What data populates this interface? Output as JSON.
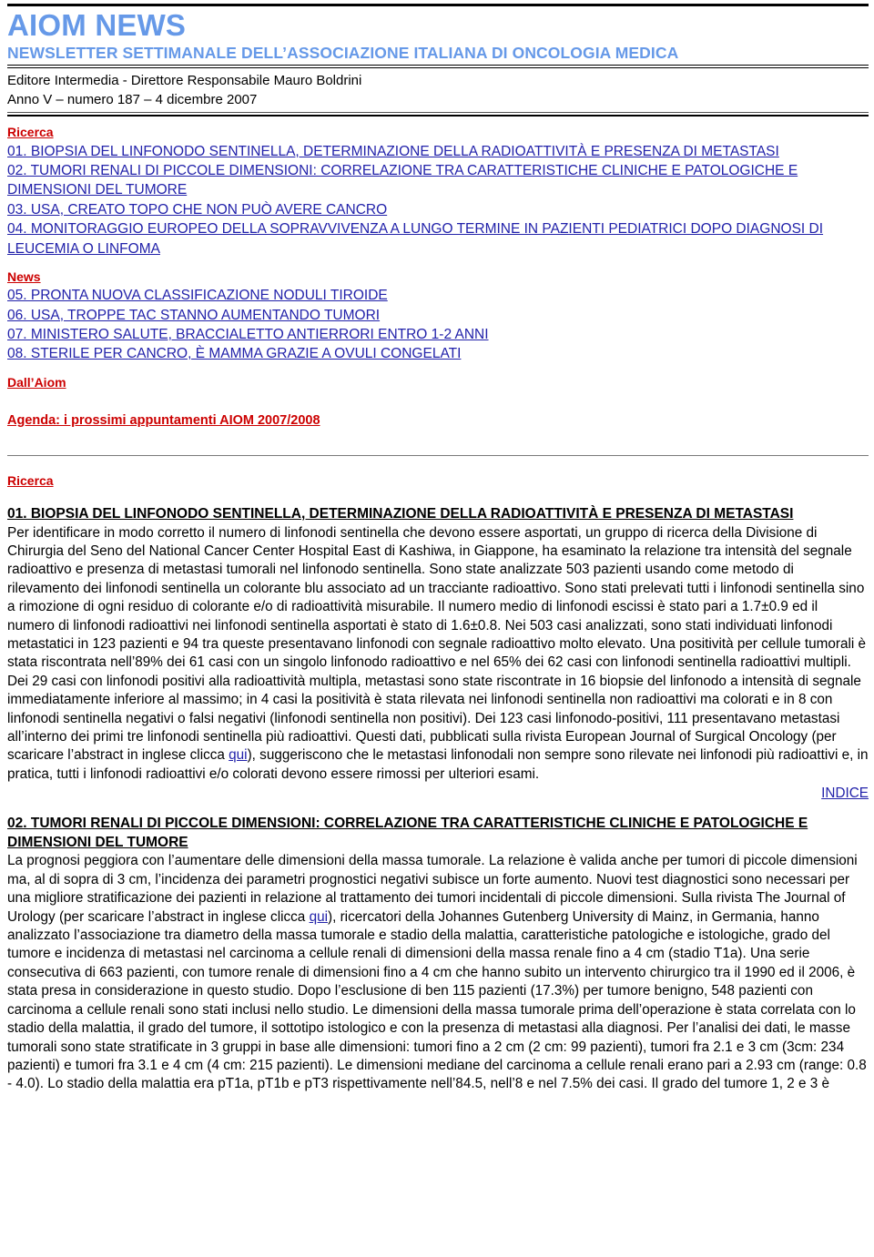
{
  "masthead": {
    "title": "AIOM NEWS",
    "subtitle": "NEWSLETTER SETTIMANALE DELL’ASSOCIAZIONE ITALIANA DI ONCOLOGIA MEDICA",
    "publisher": "Editore Intermedia - Direttore Responsabile Mauro Boldrini",
    "issue": "Anno V – numero 187 – 4 dicembre 2007",
    "title_color": "#6699e8",
    "rule_color": "#000000"
  },
  "toc": {
    "category_ricerca": "Ricerca",
    "items_ricerca": [
      "01. BIOPSIA DEL LINFONODO SENTINELLA, DETERMINAZIONE DELLA RADIOATTIVITÀ E PRESENZA DI METASTASI",
      "02. TUMORI RENALI DI PICCOLE DIMENSIONI: CORRELAZIONE TRA CARATTERISTICHE CLINICHE E PATOLOGICHE E DIMENSIONI DEL TUMORE",
      "03. USA, CREATO TOPO CHE NON PUÒ AVERE CANCRO",
      "04. MONITORAGGIO EUROPEO DELLA SOPRAVVIVENZA A LUNGO TERMINE IN PAZIENTI PEDIATRICI DOPO DIAGNOSI DI LEUCEMIA O LINFOMA"
    ],
    "category_news": "News",
    "items_news": [
      "05. PRONTA NUOVA CLASSIFICAZIONE NODULI TIROIDE",
      "06. USA, TROPPE TAC STANNO AUMENTANDO TUMORI",
      "07. MINISTERO SALUTE, BRACCIALETTO ANTIERRORI ENTRO 1-2 ANNI",
      "08. STERILE PER CANCRO, È MAMMA GRAZIE A OVULI CONGELATI"
    ],
    "category_dallaiom": "Dall’Aiom",
    "agenda": "Agenda: i prossimi appuntamenti AIOM 2007/2008",
    "link_color": "#2222aa",
    "category_color": "#cc0000"
  },
  "section": {
    "category_ricerca": "Ricerca"
  },
  "article1": {
    "title": "01. BIOPSIA DEL LINFONODO SENTINELLA, DETERMINAZIONE DELLA RADIOATTIVITÀ E PRESENZA DI METASTASI",
    "body_part1": "Per identificare in modo corretto il numero di linfonodi sentinella che devono essere asportati, un gruppo di ricerca della Divisione di Chirurgia del Seno del National Cancer Center Hospital East di Kashiwa, in Giappone, ha esaminato la relazione tra intensità del segnale radioattivo e presenza di metastasi tumorali nel linfonodo sentinella. Sono state analizzate 503 pazienti usando come metodo di rilevamento dei linfonodi sentinella un colorante blu associato ad un tracciante radioattivo. Sono stati prelevati tutti i linfonodi sentinella sino a rimozione di ogni residuo di colorante e/o di radioattività misurabile. Il numero medio di linfonodi escissi è stato pari a 1.7±0.9 ed il numero di linfonodi radioattivi nei linfonodi sentinella asportati è stato di 1.6±0.8. Nei 503 casi analizzati, sono stati individuati linfonodi metastatici in 123 pazienti e 94 tra queste presentavano linfonodi con segnale radioattivo molto elevato. Una positività per cellule tumorali è stata riscontrata nell’89% dei 61 casi con un singolo linfonodo radioattivo e nel 65% dei 62 casi con linfonodi sentinella radioattivi multipli. Dei 29 casi con linfonodi positivi alla radioattività multipla, metastasi sono state riscontrate in 16 biopsie del linfonodo a intensità di segnale immediatamente inferiore al massimo; in 4 casi la positività è stata rilevata nei linfonodi sentinella non radioattivi ma colorati e in 8 con linfonodi sentinella negativi o falsi negativi (linfonodi sentinella non positivi). Dei 123 casi linfonodo-positivi, 111 presentavano metastasi all’interno dei primi tre linfonodi sentinella più radioattivi. Questi dati, pubblicati sulla rivista European Journal of Surgical Oncology (per scaricare l’abstract in inglese clicca ",
    "link_label": "qui",
    "body_part2": "), suggeriscono che le metastasi linfonodali non sempre sono rilevate nei linfonodi più radioattivi e, in pratica, tutti i linfonodi radioattivi e/o colorati devono essere rimossi per ulteriori esami.",
    "indice_label": "INDICE"
  },
  "article2": {
    "title": "02. TUMORI RENALI DI PICCOLE DIMENSIONI: CORRELAZIONE TRA CARATTERISTICHE CLINICHE E PATOLOGICHE E DIMENSIONI DEL TUMORE",
    "body_part1": "La prognosi peggiora con l’aumentare delle dimensioni della massa tumorale. La relazione è valida anche per tumori di piccole dimensioni ma, al di sopra di 3 cm, l’incidenza dei parametri prognostici negativi subisce un forte aumento. Nuovi test diagnostici sono necessari per una migliore stratificazione dei pazienti in relazione al trattamento dei tumori incidentali di piccole dimensioni. Sulla rivista The Journal of Urology (per scaricare l’abstract in inglese clicca ",
    "link_label": "qui",
    "body_part2": "), ricercatori della Johannes Gutenberg University di Mainz, in Germania, hanno analizzato l’associazione tra diametro della massa tumorale e stadio della malattia, caratteristiche patologiche e istologiche, grado del tumore e incidenza di metastasi nel carcinoma a cellule renali di dimensioni della massa renale fino a 4 cm (stadio T1a). Una serie consecutiva di 663 pazienti, con tumore renale di dimensioni fino a 4 cm che hanno subito un intervento chirurgico tra il 1990 ed il 2006, è stata presa in considerazione in questo studio. Dopo l’esclusione di ben 115 pazienti (17.3%) per tumore benigno, 548 pazienti con carcinoma a cellule renali sono stati inclusi nello studio. Le dimensioni della massa tumorale prima dell’operazione è stata correlata con lo stadio della malattia, il grado del tumore, il sottotipo istologico e con la presenza di metastasi alla diagnosi. Per l’analisi dei dati, le masse tumorali sono state stratificate in 3 gruppi in base alle dimensioni: tumori fino a 2 cm (2 cm: 99 pazienti), tumori fra 2.1 e 3 cm (3cm: 234 pazienti) e tumori fra 3.1 e 4 cm (4 cm: 215 pazienti). Le dimensioni mediane del carcinoma a cellule renali erano pari a 2.93 cm (range: 0.8 - 4.0). Lo stadio della malattia era pT1a, pT1b e pT3 rispettivamente nell’84.5, nell’8 e nel 7.5% dei casi. Il grado del tumore 1, 2 e 3 è"
  }
}
